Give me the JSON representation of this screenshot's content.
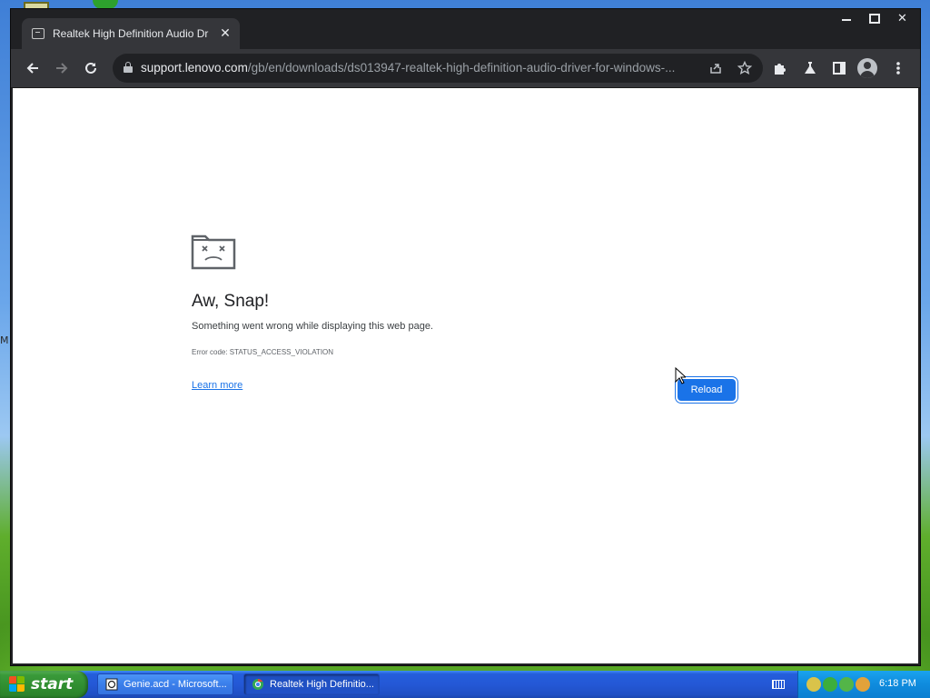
{
  "browser": {
    "tab": {
      "title": "Realtek High Definition Audio Driver",
      "close_label": "✕"
    },
    "window_controls": {
      "minimize": "minimize",
      "maximize": "maximize",
      "close": "✕"
    },
    "address_bar": {
      "host": "support.lenovo.com",
      "path": "/gb/en/downloads/ds013947-realtek-high-definition-audio-driver-for-windows-..."
    }
  },
  "error_page": {
    "title": "Aw, Snap!",
    "message": "Something went wrong while displaying this web page.",
    "error_code": "Error code: STATUS_ACCESS_VIOLATION",
    "learn_more": "Learn more",
    "reload_label": "Reload"
  },
  "desktop": {
    "edge_text": "M"
  },
  "taskbar": {
    "start_label": "start",
    "tasks": [
      {
        "label": "Genie.acd - Microsoft...",
        "active": false
      },
      {
        "label": "Realtek High Definitio...",
        "active": true
      }
    ],
    "clock": "6:18 PM"
  },
  "colors": {
    "accent": "#1a73e8",
    "chrome_dark": "#35363a",
    "xp_taskbar": "#245edb",
    "xp_start": "#3a9a3a"
  }
}
